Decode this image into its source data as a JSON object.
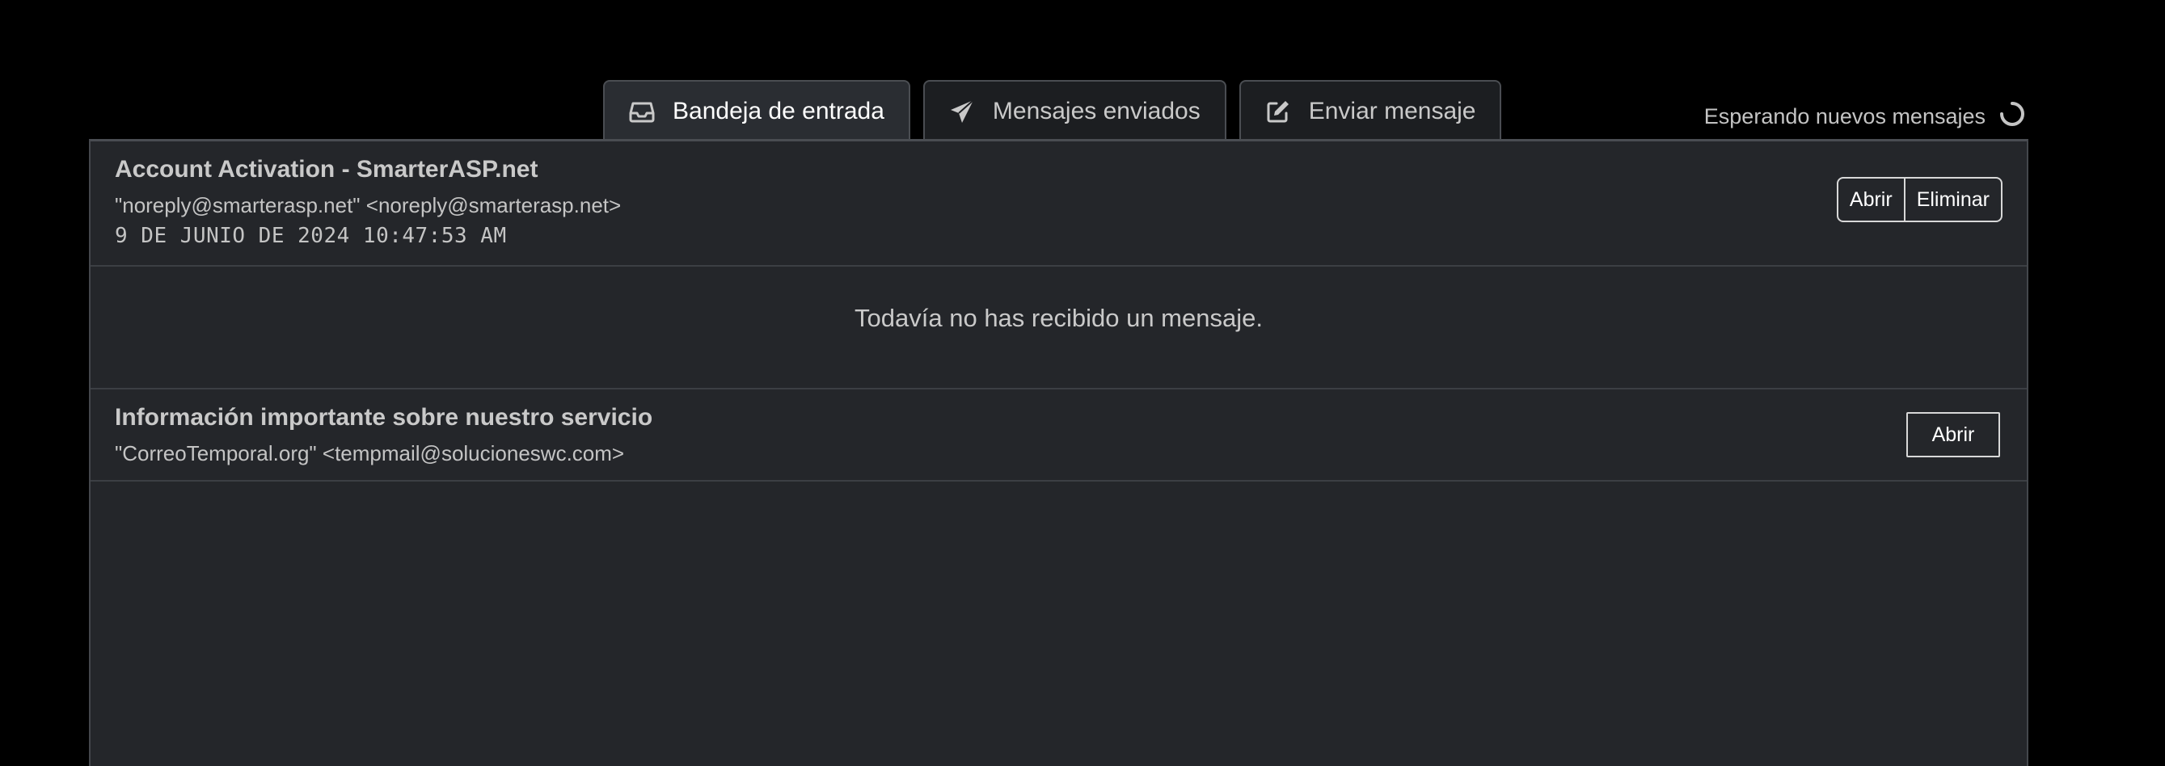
{
  "tabs": [
    {
      "label": "Bandeja de entrada",
      "icon": "inbox-icon",
      "active": true
    },
    {
      "label": "Mensajes enviados",
      "icon": "paper-plane-icon",
      "active": false
    },
    {
      "label": "Enviar mensaje",
      "icon": "edit-icon",
      "active": false
    }
  ],
  "status": {
    "text": "Esperando nuevos mensajes",
    "icon": "spinner-icon"
  },
  "messages": [
    {
      "subject": "Account Activation - SmarterASP.net",
      "sender": "\"noreply@smarterasp.net\" <noreply@smarterasp.net>",
      "date": "9 DE JUNIO DE 2024 10:47:53 AM",
      "open_label": "Abrir",
      "delete_label": "Eliminar"
    },
    {
      "subject": "Información importante sobre nuestro servicio",
      "sender": "\"CorreoTemporal.org\" <tempmail@solucioneswc.com>",
      "open_label": "Abrir"
    }
  ],
  "empty_notice": "Todavía no has recibido un mensaje.",
  "colors": {
    "background": "#000000",
    "panel": "#24262a",
    "border": "#44474c",
    "text": "#c9c9c9"
  }
}
